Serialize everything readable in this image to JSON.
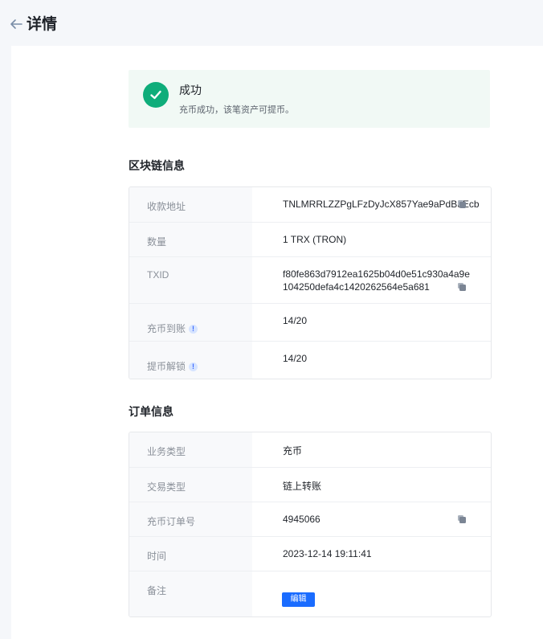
{
  "header": {
    "title": "详情"
  },
  "status": {
    "title": "成功",
    "description": "充币成功，该笔资产可提币。",
    "color": "#0fad7a"
  },
  "blockchain": {
    "section_title": "区块链信息",
    "rows": [
      {
        "label": "收款地址",
        "value": "TNLMRRLZZPgLFzDyJcX857Yae9aPdBuEcb"
      },
      {
        "label": "数量",
        "value": "1 TRX (TRON)"
      },
      {
        "label": "TXID",
        "value_line1": "f80fe863d7912ea1625b04d0e51c930a4a9e",
        "value_line2": "104250defa4c1420262564e5a681"
      },
      {
        "label": "充币到账",
        "value": "14/20"
      },
      {
        "label": "提币解锁",
        "value": "14/20"
      }
    ]
  },
  "order": {
    "section_title": "订单信息",
    "rows": [
      {
        "label": "业务类型",
        "value": "充币"
      },
      {
        "label": "交易类型",
        "value": "链上转账"
      },
      {
        "label": "充币订单号",
        "value": "4945066"
      },
      {
        "label": "时间",
        "value": "2023-12-14 19:11:41"
      },
      {
        "label": "备注",
        "edit_label": "编辑"
      }
    ]
  },
  "icons": {
    "back": "arrow-left-icon",
    "status": "checkmark-circle-icon",
    "copy": "copy-icon",
    "info": "info-icon"
  },
  "accent_color": "#1a6cff"
}
